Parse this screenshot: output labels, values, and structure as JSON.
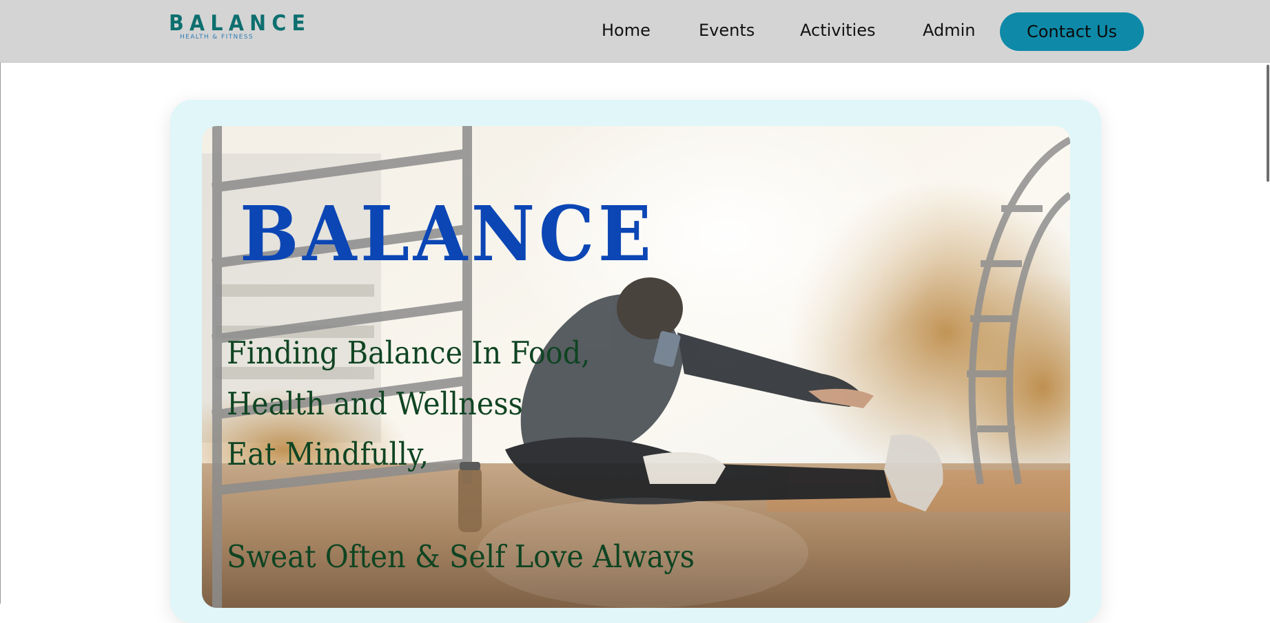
{
  "logo": {
    "name": "BALANCE",
    "tagline": "HEALTH & FITNESS"
  },
  "nav": {
    "items": [
      {
        "label": "Home"
      },
      {
        "label": "Events"
      },
      {
        "label": "Activities"
      },
      {
        "label": "Admin"
      }
    ],
    "contact_label": "Contact Us"
  },
  "hero": {
    "title": "BALANCE",
    "lines": [
      "Finding Balance In Food,",
      "Health and Wellness",
      "Eat Mindfully,",
      "Sweat Often & Self Love Always"
    ],
    "image_subject": "man-stretching-outdoors"
  },
  "colors": {
    "navbar_bg": "#d4d4d4",
    "contact_button": "#0e8aa8",
    "hero_card_bg": "#e0f6f9",
    "hero_title": "#0c46b5",
    "hero_text": "#0f4422",
    "logo_text": "#0e6f6f"
  }
}
